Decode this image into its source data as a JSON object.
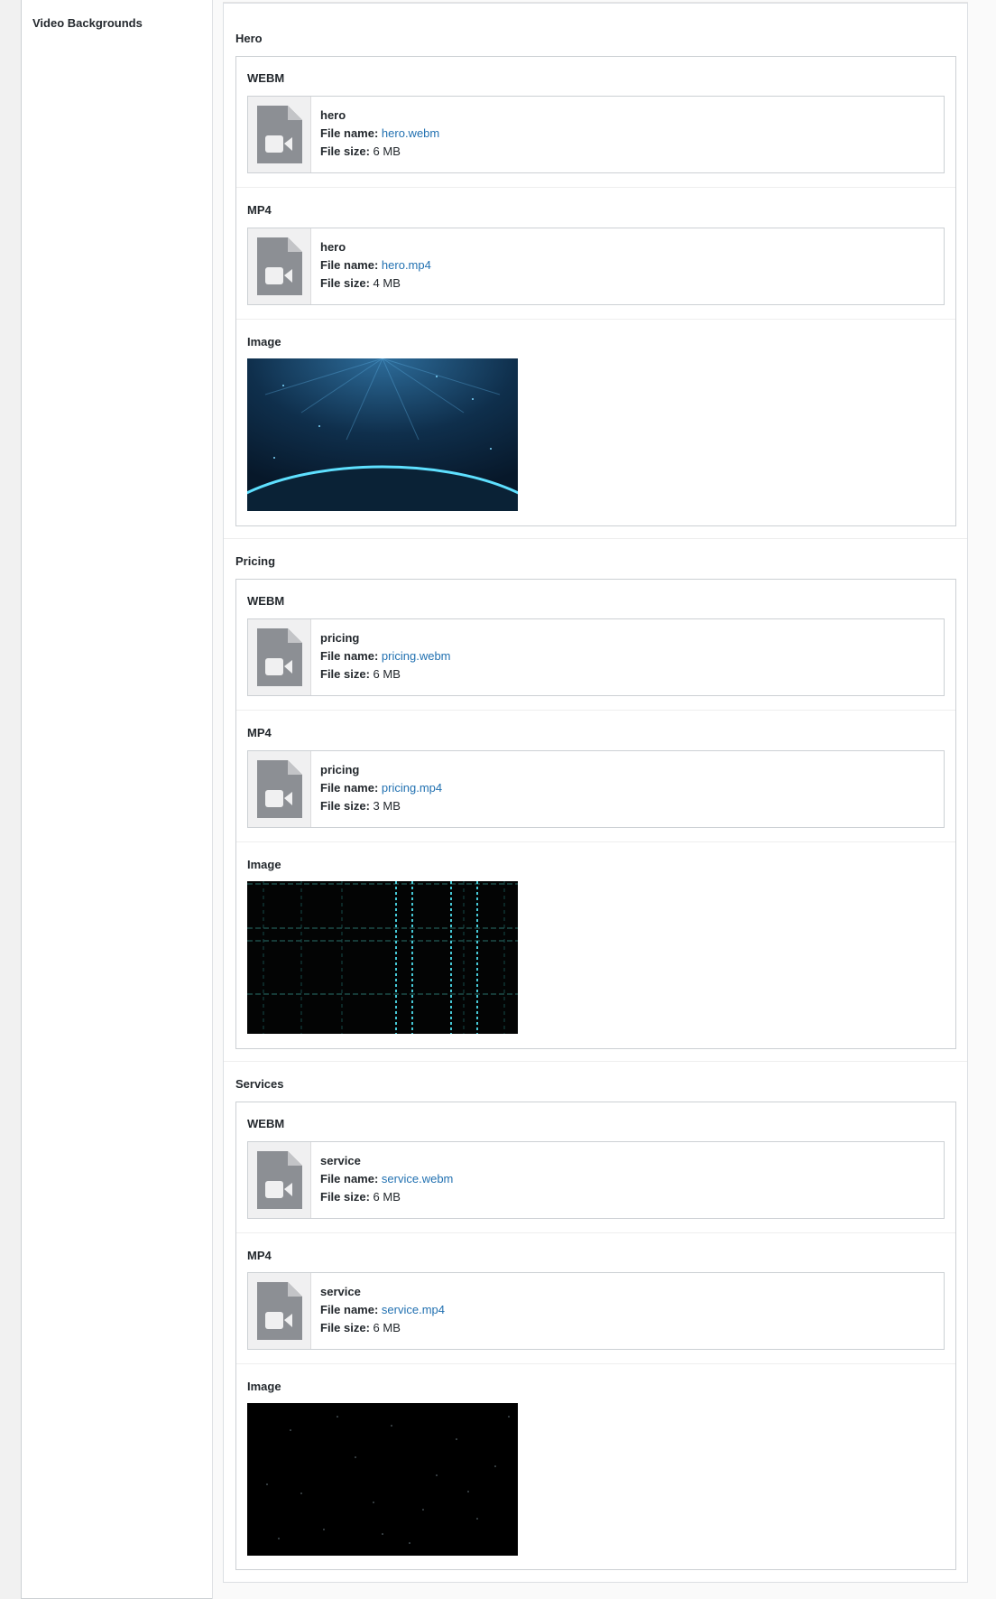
{
  "field_label": "Video Backgrounds",
  "labels": {
    "file_name": "File name:",
    "file_size": "File size:",
    "webm": "WEBM",
    "mp4": "MP4",
    "image": "Image"
  },
  "groups": [
    {
      "title": "Hero",
      "webm": {
        "title": "hero",
        "file_name": "hero.webm",
        "file_size": "6 MB"
      },
      "mp4": {
        "title": "hero",
        "file_name": "hero.mp4",
        "file_size": "4 MB"
      },
      "image_icon": "earth-glow-image"
    },
    {
      "title": "Pricing",
      "webm": {
        "title": "pricing",
        "file_name": "pricing.webm",
        "file_size": "6 MB"
      },
      "mp4": {
        "title": "pricing",
        "file_name": "pricing.mp4",
        "file_size": "3 MB"
      },
      "image_icon": "cyan-grid-image"
    },
    {
      "title": "Services",
      "webm": {
        "title": "service",
        "file_name": "service.webm",
        "file_size": "6 MB"
      },
      "mp4": {
        "title": "service",
        "file_name": "service.mp4",
        "file_size": "6 MB"
      },
      "image_icon": "starfield-image"
    }
  ],
  "colors": {
    "link": "#2271b1",
    "icon_gray": "#8c8f94"
  }
}
